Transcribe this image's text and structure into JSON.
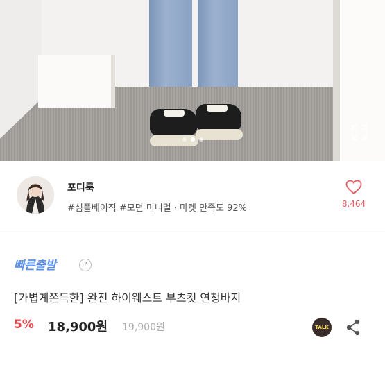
{
  "hero": {
    "slides_total": 3,
    "active_slide": 1,
    "expand_icon": "expand-icon"
  },
  "seller": {
    "name": "포디룩",
    "tags": "#심플베이직 #모던 미니멀 · 마켓 만족도 92%",
    "likes": "8,464",
    "like_icon": "heart-icon",
    "like_color": "#e25b61"
  },
  "product": {
    "badge": "빠른출발",
    "help": "?",
    "title": "[가볍게쫀득한] 완전 하이웨스트 부츠컷 연청바지",
    "discount": "5%",
    "price": "18,900원",
    "original_price": "19,900원",
    "talk_label": "TALK",
    "share_icon": "share-icon",
    "accent_blue": "#5c8fe3",
    "accent_red": "#e2474a"
  }
}
